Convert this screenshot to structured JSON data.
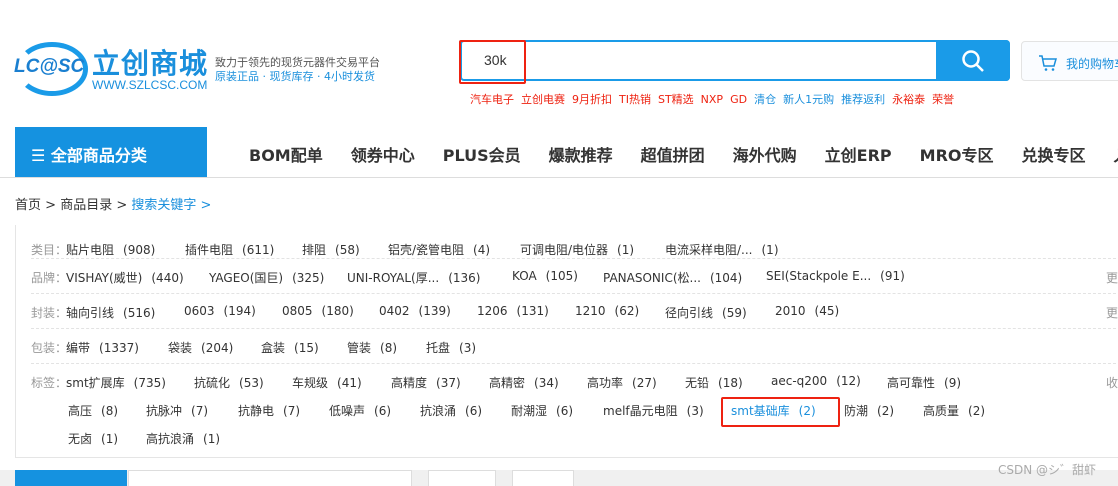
{
  "header": {
    "logo_text": "LC@SC",
    "brand": "立创商城",
    "url": "WWW.SZLCSC.COM",
    "slogan": "致力于领先的现货元器件交易平台",
    "slogan2": "原装正品 · 现货库存 · 4小时发货"
  },
  "search": {
    "value": "30k",
    "hot": [
      {
        "t": "汽车电子",
        "c": "#e21"
      },
      {
        "t": "立创电赛",
        "c": "#e21"
      },
      {
        "t": "9月折扣",
        "c": "#e21"
      },
      {
        "t": "TI热销",
        "c": "#e21"
      },
      {
        "t": "ST精选",
        "c": "#e21"
      },
      {
        "t": "NXP",
        "c": "#e21"
      },
      {
        "t": "GD",
        "c": "#e21"
      },
      {
        "t": "清仓",
        "c": "#1a8fdc"
      },
      {
        "t": "新人1元购",
        "c": "#1a8fdc"
      },
      {
        "t": "推荐返利",
        "c": "#1a8fdc"
      },
      {
        "t": "永裕泰",
        "c": "#e21"
      },
      {
        "t": "荣誉",
        "c": "#e21"
      }
    ]
  },
  "cart": {
    "label": "我的购物车"
  },
  "nav": {
    "all": "全部商品分类",
    "items": [
      "BOM配单",
      "领券中心",
      "PLUS会员",
      "爆款推荐",
      "超值拼团",
      "海外代购",
      "立创ERP",
      "MRO专区",
      "兑换专区",
      "入"
    ]
  },
  "breadcrumb": [
    "首页",
    "商品目录",
    "搜索关键字"
  ],
  "filters": {
    "category": {
      "label": "类目：",
      "items": [
        [
          "贴片电阻",
          "(908)"
        ],
        [
          "插件电阻",
          "(611)"
        ],
        [
          "排阻",
          "(58)"
        ],
        [
          "铝壳/瓷管电阻",
          "(4)"
        ],
        [
          "可调电阻/电位器",
          "(1)"
        ],
        [
          "电流采样电阻/...",
          "(1)"
        ]
      ]
    },
    "brand": {
      "label": "品牌：",
      "more": "更",
      "items": [
        [
          "VISHAY(威世)",
          "(440)"
        ],
        [
          "YAGEO(国巨)",
          "(325)"
        ],
        [
          "UNI-ROYAL(厚...",
          "(136)"
        ],
        [
          "KOA",
          "(105)"
        ],
        [
          "PANASONIC(松...",
          "(104)"
        ],
        [
          "SEI(Stackpole E...",
          "(91)"
        ]
      ]
    },
    "package": {
      "label": "封装：",
      "more": "更",
      "items": [
        [
          "轴向引线",
          "(516)"
        ],
        [
          "0603",
          "(194)"
        ],
        [
          "0805",
          "(180)"
        ],
        [
          "0402",
          "(139)"
        ],
        [
          "1206",
          "(131)"
        ],
        [
          "1210",
          "(62)"
        ],
        [
          "径向引线",
          "(59)"
        ],
        [
          "2010",
          "(45)"
        ]
      ]
    },
    "packing": {
      "label": "包装：",
      "items": [
        [
          "编带",
          "(1337)"
        ],
        [
          "袋装",
          "(204)"
        ],
        [
          "盒装",
          "(15)"
        ],
        [
          "管装",
          "(8)"
        ],
        [
          "托盘",
          "(3)"
        ]
      ]
    },
    "tags": {
      "label": "标签：",
      "collapse": "收",
      "items": [
        [
          "smt扩展库",
          "(735)"
        ],
        [
          "抗硫化",
          "(53)"
        ],
        [
          "车规级",
          "(41)"
        ],
        [
          "高精度",
          "(37)"
        ],
        [
          "高精密",
          "(34)"
        ],
        [
          "高功率",
          "(27)"
        ],
        [
          "无铅",
          "(18)"
        ],
        [
          "aec-q200",
          "(12)"
        ],
        [
          "高可靠性",
          "(9)"
        ],
        [
          "高压",
          "(8)"
        ],
        [
          "抗脉冲",
          "(7)"
        ],
        [
          "抗静电",
          "(7)"
        ],
        [
          "低噪声",
          "(6)"
        ],
        [
          "抗浪涌",
          "(6)"
        ],
        [
          "耐潮湿",
          "(6)"
        ],
        [
          "melf晶元电阻",
          "(3)"
        ],
        [
          "smt基础库",
          "(2)"
        ],
        [
          "防潮",
          "(2)"
        ],
        [
          "高质量",
          "(2)"
        ],
        [
          "无卤",
          "(1)"
        ],
        [
          "高抗浪涌",
          "(1)"
        ]
      ]
    }
  },
  "watermark": "CSDN @シ゛甜虾"
}
